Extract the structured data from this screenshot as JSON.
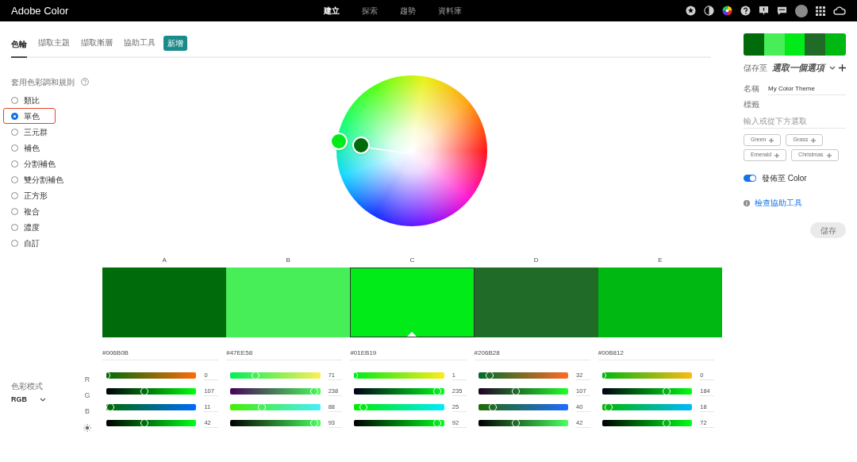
{
  "app": {
    "title": "Adobe Color"
  },
  "nav": [
    {
      "label": "建立",
      "selected": true
    },
    {
      "label": "探索",
      "selected": false
    },
    {
      "label": "趨勢",
      "selected": false
    },
    {
      "label": "資料庫",
      "selected": false
    }
  ],
  "tabs": [
    {
      "label": "色輪",
      "selected": true
    },
    {
      "label": "擷取主題",
      "selected": false
    },
    {
      "label": "擷取漸層",
      "selected": false
    },
    {
      "label": "協助工具",
      "selected": false
    }
  ],
  "new_badge": "新增",
  "harmony": {
    "label": "套用色彩調和規則",
    "rules": [
      {
        "label": "類比",
        "selected": false
      },
      {
        "label": "單色",
        "selected": true
      },
      {
        "label": "三元群",
        "selected": false
      },
      {
        "label": "補色",
        "selected": false
      },
      {
        "label": "分割補色",
        "selected": false
      },
      {
        "label": "雙分割補色",
        "selected": false
      },
      {
        "label": "正方形",
        "selected": false
      },
      {
        "label": "複合",
        "selected": false
      },
      {
        "label": "濃度",
        "selected": false
      },
      {
        "label": "自訂",
        "selected": false
      }
    ]
  },
  "channel_labels": [
    {
      "kind": "r",
      "label": "R"
    },
    {
      "kind": "g",
      "label": "G"
    },
    {
      "kind": "b",
      "label": "B"
    },
    {
      "kind": "brightness"
    }
  ],
  "swatches": [
    {
      "label": "A",
      "hex": "#006B0B",
      "color": "#006b0b",
      "selected": false,
      "channels": [
        {
          "kind": "r",
          "value": "0",
          "level": 0
        },
        {
          "kind": "g",
          "value": "107",
          "level": 0.42
        },
        {
          "kind": "b",
          "value": "11",
          "level": 0.04
        },
        {
          "kind": "brightness",
          "value": "42",
          "level": 0.42
        }
      ]
    },
    {
      "label": "B",
      "hex": "#47EE58",
      "color": "#47ee58",
      "selected": false,
      "channels": [
        {
          "kind": "r",
          "value": "71",
          "level": 0.28
        },
        {
          "kind": "g",
          "value": "238",
          "level": 0.93
        },
        {
          "kind": "b",
          "value": "88",
          "level": 0.35
        },
        {
          "kind": "brightness",
          "value": "93",
          "level": 0.93
        }
      ]
    },
    {
      "label": "C",
      "hex": "#01EB19",
      "color": "#01eb19",
      "selected": true,
      "channels": [
        {
          "kind": "r",
          "value": "1",
          "level": 0.0
        },
        {
          "kind": "g",
          "value": "235",
          "level": 0.92
        },
        {
          "kind": "b",
          "value": "25",
          "level": 0.1
        },
        {
          "kind": "brightness",
          "value": "92",
          "level": 0.92
        }
      ]
    },
    {
      "label": "D",
      "hex": "#206B28",
      "color": "#206b28",
      "selected": false,
      "channels": [
        {
          "kind": "r",
          "value": "32",
          "level": 0.13
        },
        {
          "kind": "g",
          "value": "107",
          "level": 0.42
        },
        {
          "kind": "b",
          "value": "40",
          "level": 0.16
        },
        {
          "kind": "brightness",
          "value": "42",
          "level": 0.42
        }
      ]
    },
    {
      "label": "E",
      "hex": "#00B812",
      "color": "#00b812",
      "selected": false,
      "channels": [
        {
          "kind": "r",
          "value": "0",
          "level": 0
        },
        {
          "kind": "g",
          "value": "184",
          "level": 0.72
        },
        {
          "kind": "b",
          "value": "18",
          "level": 0.07
        },
        {
          "kind": "brightness",
          "value": "72",
          "level": 0.72
        }
      ]
    }
  ],
  "color_mode": {
    "label": "色彩模式",
    "value": "RGB"
  },
  "save_to": {
    "label": "儲存至",
    "value": "選取一個選項"
  },
  "name": {
    "label": "名稱",
    "value": "My Color Theme"
  },
  "tags": {
    "label": "標籤",
    "placeholder": "輸入或從下方選取",
    "suggestions": [
      "Green",
      "Grass",
      "Emerald",
      "Christmas"
    ]
  },
  "publish": {
    "label": "發佈至 Color",
    "on": true
  },
  "accessibility_link": "檢查協助工具",
  "save_button": {
    "label": "儲存",
    "disabled": true
  }
}
